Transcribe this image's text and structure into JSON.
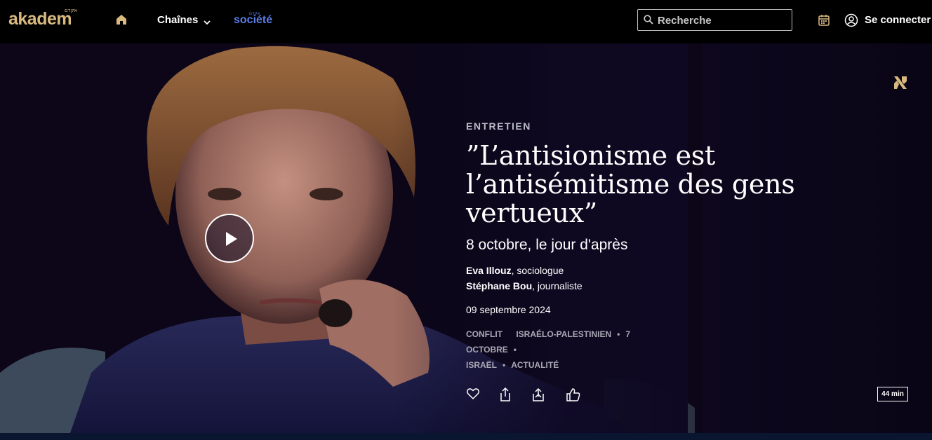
{
  "header": {
    "logo_text": "akadem",
    "logo_hebrew": "אקדם",
    "home_icon": "home-icon",
    "nav_chaines": "Chaînes",
    "societe_small": "אקדם",
    "societe_label": "société",
    "search_placeholder": "Recherche",
    "login_label": "Se connecter"
  },
  "hero": {
    "kicker": "ENTRETIEN",
    "title": "”L’antisionisme est l’antisémitisme des gens vertueux”",
    "subtitle": "8 octobre, le jour d'après",
    "people": [
      {
        "name": "Eva Illouz",
        "role": ", sociologue"
      },
      {
        "name": "Stéphane Bou",
        "role": ", journaliste"
      }
    ],
    "date": "09 septembre 2024",
    "tags": [
      "CONFLIT",
      "ISRAÉLO-PALESTINIEN",
      "7",
      "OCTOBRE",
      "ISRAËL",
      "ACTUALITÉ"
    ],
    "duration": "44 min"
  },
  "colors": {
    "brand_gold": "#d9b97f",
    "societe_blue": "#5b7de8",
    "hero_bg": "#120a2a"
  }
}
